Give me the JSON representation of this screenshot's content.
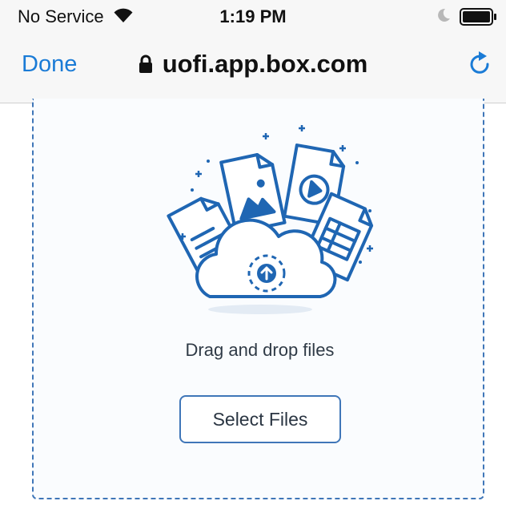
{
  "status_bar": {
    "carrier": "No Service",
    "time": "1:19 PM",
    "icons": [
      "wifi-icon",
      "moon-icon",
      "battery-icon"
    ]
  },
  "nav_bar": {
    "done_label": "Done",
    "url": "uofi.app.box.com",
    "icons": [
      "lock-icon",
      "reload-icon"
    ]
  },
  "upload": {
    "drop_label": "Drag and drop files",
    "select_label": "Select Files"
  },
  "colors": {
    "accent": "#1a7bd6",
    "dashed_border": "#3f76b8",
    "illustration_blue": "#1f66b3"
  }
}
